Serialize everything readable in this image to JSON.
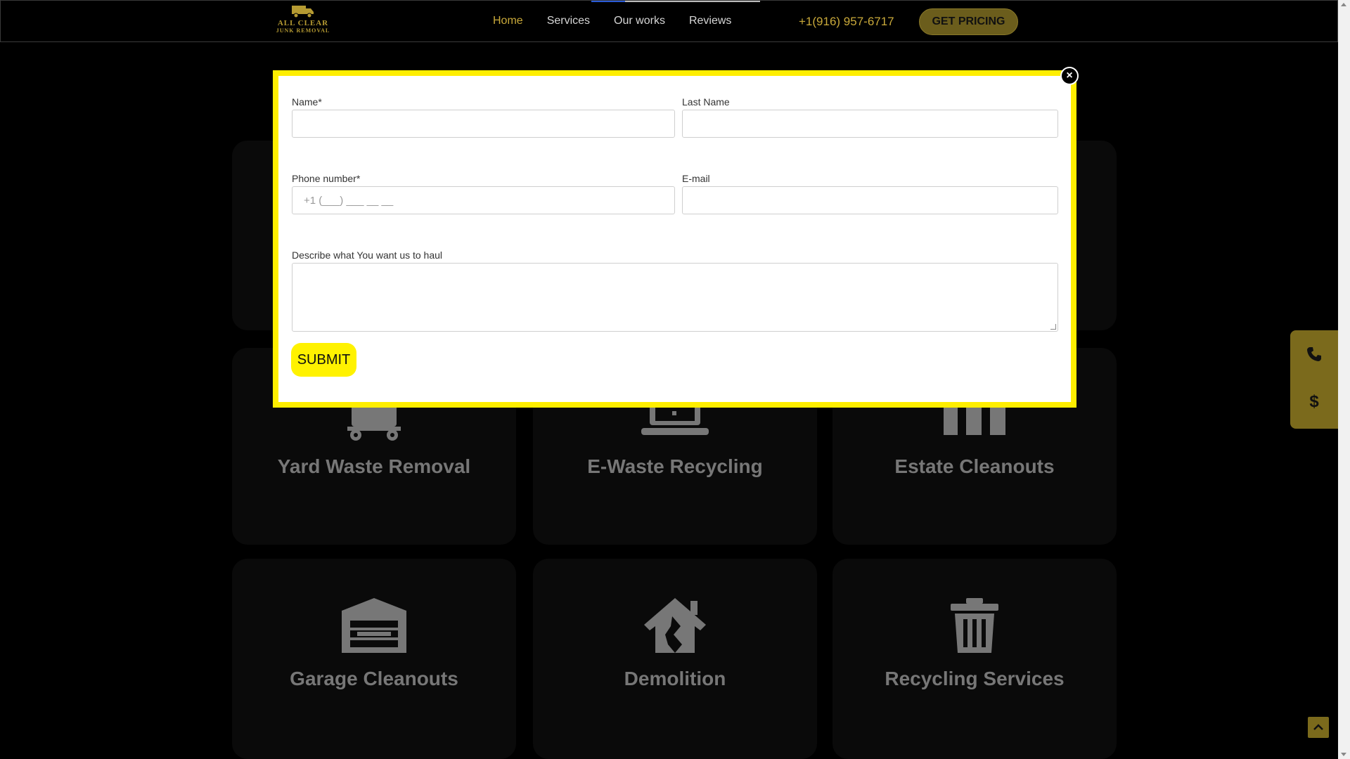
{
  "header": {
    "logo": {
      "line1": "ALL CLEAR",
      "line2": "JUNK REMOVAL",
      "icon": "truck-icon"
    },
    "nav": [
      {
        "label": "Home",
        "active": true
      },
      {
        "label": "Services",
        "active": false
      },
      {
        "label": "Our works",
        "active": false
      },
      {
        "label": "Reviews",
        "active": false
      }
    ],
    "phone": "+1(916) 957-6717",
    "cta_label": "GET PRICING"
  },
  "services": [
    {
      "title": "Yard Waste Removal",
      "icon": "dolly-icon"
    },
    {
      "title": "E-Waste Recycling",
      "icon": "laptop-icon"
    },
    {
      "title": "Estate Cleanouts",
      "icon": "building-icon"
    },
    {
      "title": "Garage Cleanouts",
      "icon": "garage-icon"
    },
    {
      "title": "Demolition",
      "icon": "broken-house-icon"
    },
    {
      "title": "Recycling Services",
      "icon": "trash-can-icon"
    }
  ],
  "side_buttons": [
    {
      "icon": "phone-icon"
    },
    {
      "icon": "dollar-icon"
    }
  ],
  "modal": {
    "close_icon": "close-icon",
    "fields": {
      "name_label": "Name*",
      "last_name_label": "Last Name",
      "phone_label": "Phone number*",
      "phone_placeholder": "+1 (___) ___ __ __",
      "email_label": "E-mail",
      "describe_label": "Describe what You want us to haul"
    },
    "submit_label": "SUBMIT"
  },
  "colors": {
    "accent_gold": "#c9a93a",
    "modal_border": "#ffee00",
    "submit_bg": "#fff200",
    "background": "#000000"
  }
}
